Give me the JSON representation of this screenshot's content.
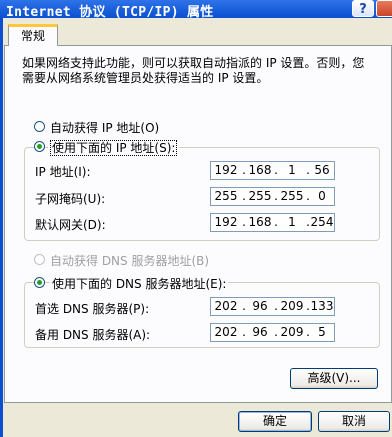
{
  "window": {
    "title": "Internet 协议 (TCP/IP) 属性",
    "help_label": "?"
  },
  "tabs": [
    {
      "label": "常规"
    }
  ],
  "description": "如果网络支持此功能，则可以获取自动指派的 IP 设置。否则，您需要从网络系统管理员处获得适当的 IP 设置。",
  "ip_section": {
    "auto_label": "自动获得 IP 地址(O)",
    "manual_label": "使用下面的 IP 地址(S):",
    "selected": "manual",
    "fields": [
      {
        "label": "IP 地址(I):",
        "octets": [
          "192",
          "168",
          "1",
          "56"
        ]
      },
      {
        "label": "子网掩码(U):",
        "octets": [
          "255",
          "255",
          "255",
          "0"
        ]
      },
      {
        "label": "默认网关(D):",
        "octets": [
          "192",
          "168",
          "1",
          "254"
        ]
      }
    ]
  },
  "dns_section": {
    "auto_label": "自动获得 DNS 服务器地址(B)",
    "manual_label": "使用下面的 DNS 服务器地址(E):",
    "selected": "manual",
    "fields": [
      {
        "label": "首选 DNS 服务器(P):",
        "octets": [
          "202",
          "96",
          "209",
          "133"
        ]
      },
      {
        "label": "备用 DNS 服务器(A):",
        "octets": [
          "202",
          "96",
          "209",
          "5"
        ]
      }
    ]
  },
  "buttons": {
    "advanced": "高级(V)...",
    "ok": "确定",
    "cancel": "取消"
  },
  "colors": {
    "title_bar": "#0A4FCF",
    "dialog_bg": "#ECE9D8",
    "panel_bg": "#FCFCFE",
    "radio_dot": "#21A121",
    "tab_accent": "#FFC83C"
  }
}
